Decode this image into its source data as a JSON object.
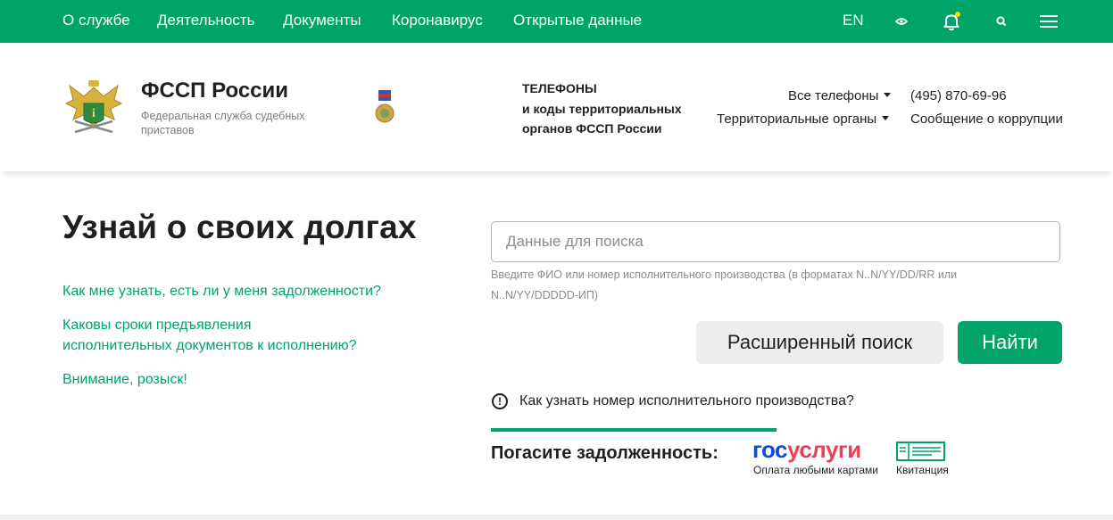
{
  "topnav": {
    "items": [
      {
        "label": "О службе"
      },
      {
        "label": "Деятельность"
      },
      {
        "label": "Документы"
      },
      {
        "label": "Коронавирус"
      },
      {
        "label": "Открытые данные"
      }
    ],
    "lang": "EN",
    "icons": [
      "eye-icon",
      "bell-icon",
      "search-icon",
      "menu-icon"
    ],
    "accent": "#00a469",
    "notification_dot_color": "#ffd800"
  },
  "header": {
    "brand_title": "ФССП России",
    "brand_subtitle": "Федеральная служба судебных приставов",
    "phones_title": "ТЕЛЕФОНЫ\nи коды территориальных\nорганов ФССП России",
    "all_phones": "Все телефоны",
    "territorial": "Территориальные органы",
    "phone": "(495) 870-69-96",
    "corruption": "Сообщение о коррупции"
  },
  "main": {
    "title": "Узнай о своих долгах",
    "links": [
      "Как мне узнать, есть ли у меня задолженности?",
      "Каковы сроки предъявления\nисполнительных документов к исполнению?",
      "Внимание, розыск!"
    ],
    "search": {
      "placeholder": "Данные для поиска",
      "value": "",
      "hint": "Введите ФИО или номер исполнительного производства (в форматах N..N/YY/DD/RR или N..N/YY/DDDDD-ИП)"
    },
    "advanced_button": "Расширенный поиск",
    "find_button": "Найти",
    "info_link": "Как узнать номер исполнительного производства?",
    "pay_label": "Погасите задолженность:",
    "gosuslugi": {
      "part1": "гос",
      "part2": "услуги",
      "caption": "Оплата любыми картами"
    },
    "receipt_caption": "Квитанция"
  }
}
